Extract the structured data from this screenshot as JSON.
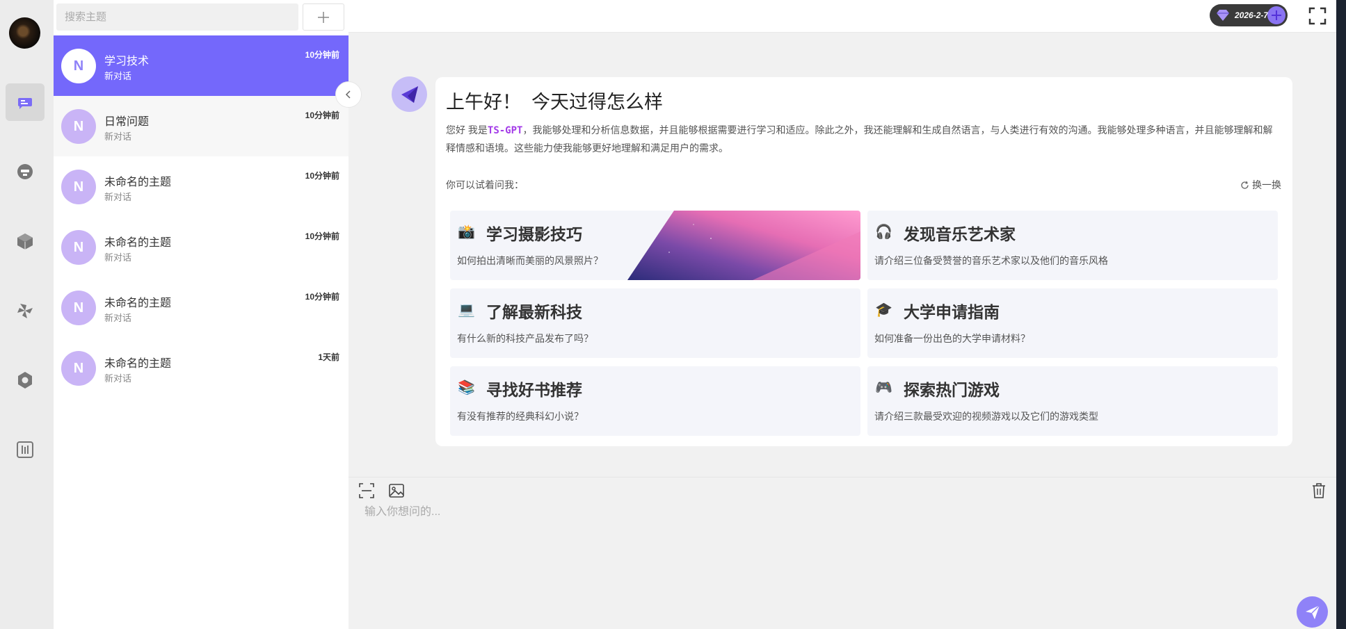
{
  "sidebar": {
    "items": [
      {
        "name": "chat",
        "icon": "chat-bubbles-icon",
        "active": true
      },
      {
        "name": "robot",
        "icon": "robot-icon"
      },
      {
        "name": "cube",
        "icon": "cube-icon"
      },
      {
        "name": "pinwheel",
        "icon": "pinwheel-icon"
      },
      {
        "name": "settings",
        "icon": "gear-icon"
      },
      {
        "name": "equalizer",
        "icon": "sliders-icon"
      }
    ]
  },
  "topics": {
    "search_placeholder": "搜索主题",
    "add_label": "+",
    "items": [
      {
        "avatar": "N",
        "title": "学习技术",
        "subtitle": "新对话",
        "time": "10分钟前"
      },
      {
        "avatar": "N",
        "title": "日常问题",
        "subtitle": "新对话",
        "time": "10分钟前"
      },
      {
        "avatar": "N",
        "title": "未命名的主题",
        "subtitle": "新对话",
        "time": "10分钟前"
      },
      {
        "avatar": "N",
        "title": "未命名的主题",
        "subtitle": "新对话",
        "time": "10分钟前"
      },
      {
        "avatar": "N",
        "title": "未命名的主题",
        "subtitle": "新对话",
        "time": "10分钟前"
      },
      {
        "avatar": "N",
        "title": "未命名的主题",
        "subtitle": "新对话",
        "time": "1天前"
      }
    ]
  },
  "header": {
    "vip_date": "2026-2-7"
  },
  "welcome": {
    "greeting": "上午好！  今天过得怎么样",
    "intro_prefix": "您好 我是",
    "brand": "TS-GPT",
    "intro_suffix": "，我能够处理和分析信息数据，并且能够根据需要进行学习和适应。除此之外，我还能理解和生成自然语言，与人类进行有效的沟通。我能够处理多种语言，并且能够理解和解释情感和语境。这些能力使我能够更好地理解和满足用户的需求。",
    "try_ask": "你可以试着问我：",
    "refresh": "换一换",
    "suggestions": [
      {
        "icon": "📸",
        "title": "学习摄影技巧",
        "desc": "如何拍出清晰而美丽的风景照片？",
        "has_image": true
      },
      {
        "icon": "🎧",
        "title": "发现音乐艺术家",
        "desc": "请介绍三位备受赞誉的音乐艺术家以及他们的音乐风格"
      },
      {
        "icon": "💻",
        "title": "了解最新科技",
        "desc": "有什么新的科技产品发布了吗？"
      },
      {
        "icon": "🎓",
        "title": "大学申请指南",
        "desc": "如何准备一份出色的大学申请材料？"
      },
      {
        "icon": "📚",
        "title": "寻找好书推荐",
        "desc": "有没有推荐的经典科幻小说？"
      },
      {
        "icon": "🎮",
        "title": "探索热门游戏",
        "desc": "请介绍三款最受欢迎的视频游戏以及它们的游戏类型"
      }
    ]
  },
  "composer": {
    "placeholder": "输入你想问的..."
  },
  "colors": {
    "accent": "#7468fb",
    "avatar": "#c9b4f6",
    "brand_text": "#a33be8"
  }
}
